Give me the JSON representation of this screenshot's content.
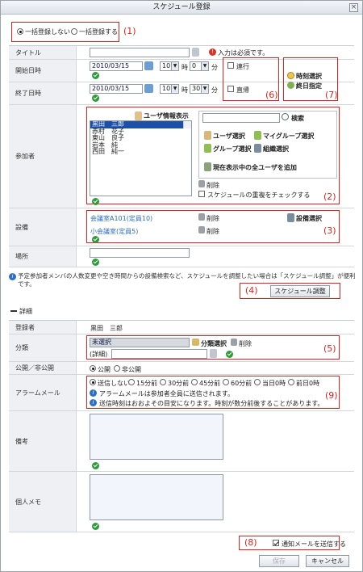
{
  "window": {
    "title": "スケジュール登録",
    "close": "×"
  },
  "bulk": {
    "option_no": "一括登録しない",
    "option_yes": "一括登録する"
  },
  "labels": {
    "title": "タイトル",
    "start": "開始日時",
    "end": "終了日時",
    "participants": "参加者",
    "equipment": "設備",
    "place": "場所",
    "registrant": "登録者",
    "category": "分類",
    "visibility": "公開／非公開",
    "alarm": "アラームメール",
    "remarks": "備考",
    "memo": "個人メモ"
  },
  "title_field": {
    "value": "",
    "required_msg": "入力は必須です。"
  },
  "start": {
    "date": "2010/03/15",
    "hour": "10",
    "hour_unit": "時",
    "minute": "0",
    "minute_unit": "分",
    "repeat_label": "連行"
  },
  "end": {
    "date": "2010/03/15",
    "hour": "10",
    "hour_unit": "時",
    "minute": "30",
    "minute_unit": "分",
    "return_label": "直帰"
  },
  "time_options": {
    "time_select": "時刻選択",
    "all_day": "終日指定"
  },
  "participants": {
    "user_info": "ユーザ情報表示",
    "list": [
      "黒田　三郎",
      "赤村　花子",
      "東山　良子",
      "岩本　純",
      "西田　純一"
    ],
    "search_button": "検索",
    "user_select": "ユーザ選択",
    "mygroup_select": "マイグループ選択",
    "group_select": "グループ選択",
    "org_select": "組織選択",
    "add_all": "現在表示中の全ユーザを追加",
    "delete": "削除",
    "overlap_check": "スケジュールの重複をチェックする"
  },
  "equipment": {
    "items": [
      {
        "name": "会議室A101(定員10)",
        "delete": "削除"
      },
      {
        "name": "小会議室(定員5)",
        "delete": "削除"
      }
    ],
    "select_button": "設備選択"
  },
  "note": "予定参加者メンバの人数変更や空き時間からの設備検索など、スケジュールを調整したい場合は「スケジュール調整」が便利です。",
  "adjust_button": "スケジュール調整",
  "details": {
    "header": "詳細",
    "registrant": "黒田　三郎"
  },
  "category": {
    "value": "未選択",
    "select": "分類選択",
    "delete": "削除",
    "detail_label": "(詳細)",
    "detail_value": ""
  },
  "visibility": {
    "public": "公開",
    "private": "非公開"
  },
  "alarm": {
    "options": [
      "送信しない",
      "15分前",
      "30分前",
      "45分前",
      "60分前",
      "当日0時",
      "前日0時"
    ],
    "note1": "アラームメールは参加者全員に送信されます。",
    "note2": "送信時刻はおおよその目安になります。時刻が数分前後することがあります。"
  },
  "notify": {
    "label": "通知メールを送信する"
  },
  "buttons": {
    "save": "保存",
    "cancel": "キャンセル"
  },
  "callouts": [
    "(1)",
    "(2)",
    "(3)",
    "(4)",
    "(5)",
    "(6)",
    "(7)",
    "(8)",
    "(9)"
  ],
  "colors": {
    "callout": "#e0201b",
    "label_bg": "#eef0f3",
    "selected": "#1b4fa8",
    "ok": "#2e9b3b"
  }
}
